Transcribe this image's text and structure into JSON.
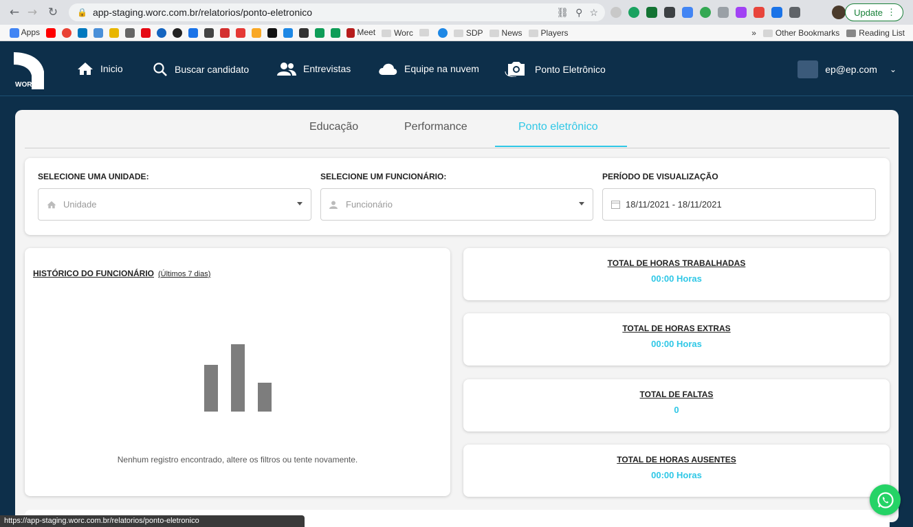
{
  "browser": {
    "url": "app-staging.worc.com.br/relatorios/ponto-eletronico",
    "update_label": "Update",
    "status_url": "https://app-staging.worc.com.br/relatorios/ponto-eletronico"
  },
  "bookmarks": {
    "apps": "Apps",
    "meet": "Meet",
    "worc": "Worc",
    "sdp": "SDP",
    "news": "News",
    "players": "Players",
    "more": "»",
    "other": "Other Bookmarks",
    "reading": "Reading List"
  },
  "header": {
    "logo_text": "WORC",
    "nav": [
      {
        "label": "Inicio"
      },
      {
        "label": "Buscar candidato"
      },
      {
        "label": "Entrevistas"
      },
      {
        "label": "Equipe na nuvem"
      },
      {
        "label": "Ponto Eletrônico"
      }
    ],
    "user_email": "ep@ep.com"
  },
  "tabs": [
    {
      "label": "Educação"
    },
    {
      "label": "Performance"
    },
    {
      "label": "Ponto eletrônico"
    }
  ],
  "filters": {
    "unit_label": "SELECIONE UMA UNIDADE:",
    "unit_placeholder": "Unidade",
    "employee_label": "SELECIONE UM FUNCIONÁRIO:",
    "employee_placeholder": "Funcionário",
    "period_label": "PERÍODO DE VISUALIZAÇÃO",
    "period_value": "18/11/2021 - 18/11/2021"
  },
  "history": {
    "title": "HISTÓRICO DO FUNCIONÁRIO",
    "subtitle": "(Últimos 7 dias)",
    "empty_message": "Nenhum registro encontrado, altere os filtros ou tente novamente."
  },
  "stats": [
    {
      "label": "TOTAL DE HORAS TRABALHADAS",
      "value": "00:00 Horas"
    },
    {
      "label": "TOTAL DE HORAS EXTRAS",
      "value": "00:00 Horas"
    },
    {
      "label": "TOTAL DE FALTAS",
      "value": "0"
    },
    {
      "label": "TOTAL DE HORAS AUSENTES",
      "value": "00:00 Horas"
    }
  ],
  "colors": {
    "navy": "#0d2f4a",
    "accent": "#2ec7e6",
    "whatsapp": "#25d366"
  }
}
